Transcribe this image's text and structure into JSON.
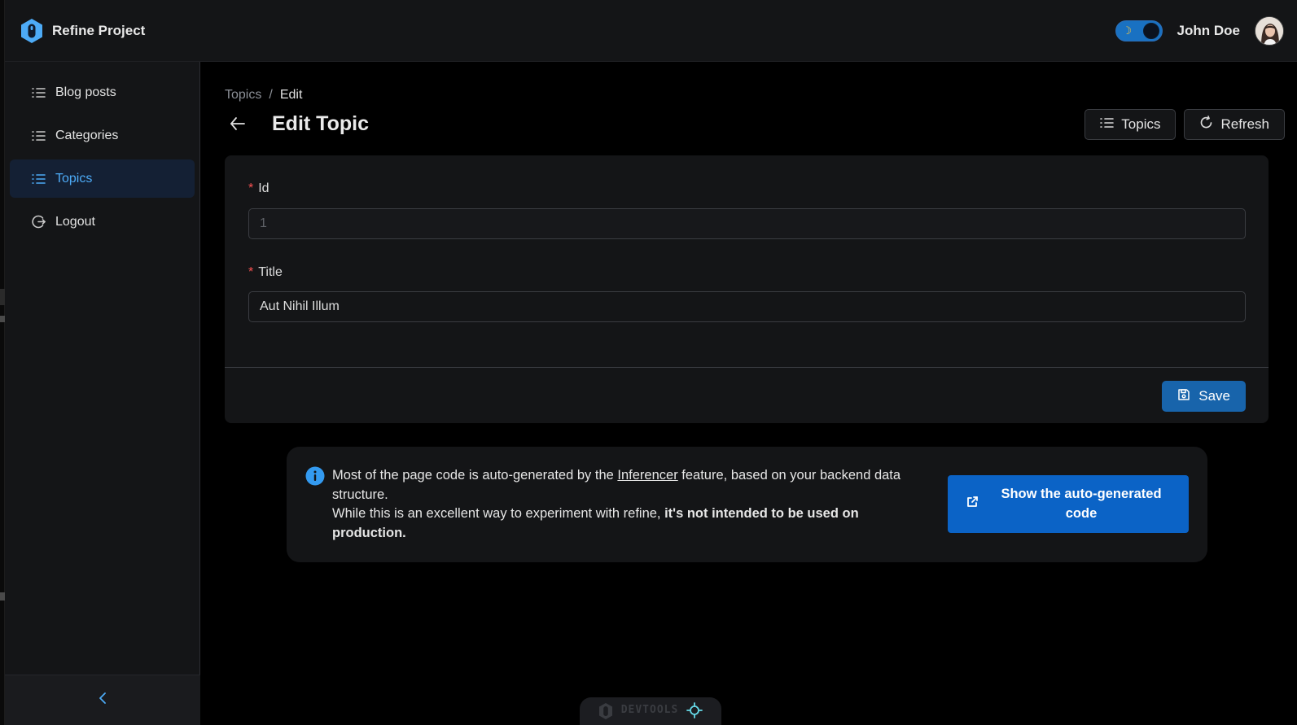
{
  "header": {
    "brand_title": "Refine Project",
    "user_name": "John Doe",
    "theme_icon": "moon-icon"
  },
  "sidebar": {
    "items": [
      {
        "label": "Blog posts",
        "icon": "list-icon",
        "active": false
      },
      {
        "label": "Categories",
        "icon": "list-icon",
        "active": false
      },
      {
        "label": "Topics",
        "icon": "list-icon",
        "active": true
      },
      {
        "label": "Logout",
        "icon": "logout-icon",
        "active": false
      }
    ],
    "collapse_icon": "chevron-left-icon"
  },
  "breadcrumb": {
    "parent": "Topics",
    "separator": "/",
    "current": "Edit"
  },
  "page": {
    "title": "Edit Topic",
    "actions": {
      "list_label": "Topics",
      "refresh_label": "Refresh"
    }
  },
  "form": {
    "id_field": {
      "label": "Id",
      "value": "1",
      "disabled": true
    },
    "title_field": {
      "label": "Title",
      "value": "Aut Nihil Illum"
    },
    "save_label": "Save"
  },
  "info": {
    "text_part1": "Most of the page code is auto-generated by the ",
    "link_text": "Inferencer",
    "text_part2": " feature, based on your backend data structure.",
    "text_part3": "While this is an excellent way to experiment with refine, ",
    "bold_text": "it's not intended to be used on production.",
    "button_label": "Show the auto-generated code"
  },
  "devtools": {
    "label": "DEVTOOLS"
  },
  "colors": {
    "accent": "#4dabf7",
    "primary_button": "#1864ab",
    "required": "#fa5252",
    "info_button": "#0b63c6"
  }
}
